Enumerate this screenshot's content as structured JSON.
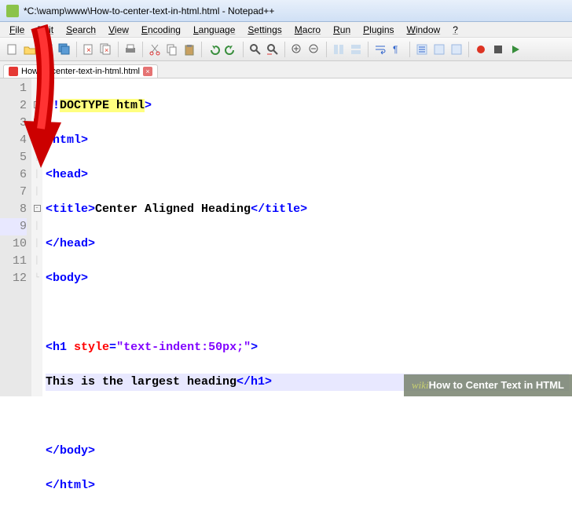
{
  "titlebar": {
    "text": "*C:\\wamp\\www\\How-to-center-text-in-html.html - Notepad++"
  },
  "menubar": [
    "File",
    "Edit",
    "Search",
    "View",
    "Encoding",
    "Language",
    "Settings",
    "Macro",
    "Run",
    "Plugins",
    "Window",
    "?"
  ],
  "tab": {
    "name": "How-to-center-text-in-html.html"
  },
  "gutter": [
    "1",
    "2",
    "3",
    "4",
    "5",
    "6",
    "7",
    "8",
    "9",
    "10",
    "11",
    "12"
  ],
  "code": {
    "l1": {
      "doctype_open": "<!",
      "doctype_text": "DOCTYPE html",
      "doctype_close": ">"
    },
    "l2": {
      "tag": "<html>"
    },
    "l3": {
      "tag": "<head>"
    },
    "l4": {
      "open": "<title>",
      "text": "Center Aligned Heading",
      "close": "</title>"
    },
    "l5": {
      "tag": "</head>"
    },
    "l6": {
      "tag": "<body>"
    },
    "l7": {
      "text": ""
    },
    "l8": {
      "open": "<h1",
      "sp": " ",
      "attr": "style",
      "eq": "=",
      "val": "\"text-indent:50px;\"",
      "close": ">"
    },
    "l9": {
      "text": "This is the largest heading",
      "close": "</h1>"
    },
    "l10": {
      "text": ""
    },
    "l11": {
      "tag": "</body>"
    },
    "l12": {
      "tag": "</html>"
    }
  },
  "watermark": {
    "brand": "wiki",
    "how": "How to ",
    "title": "Center Text in HTML"
  }
}
